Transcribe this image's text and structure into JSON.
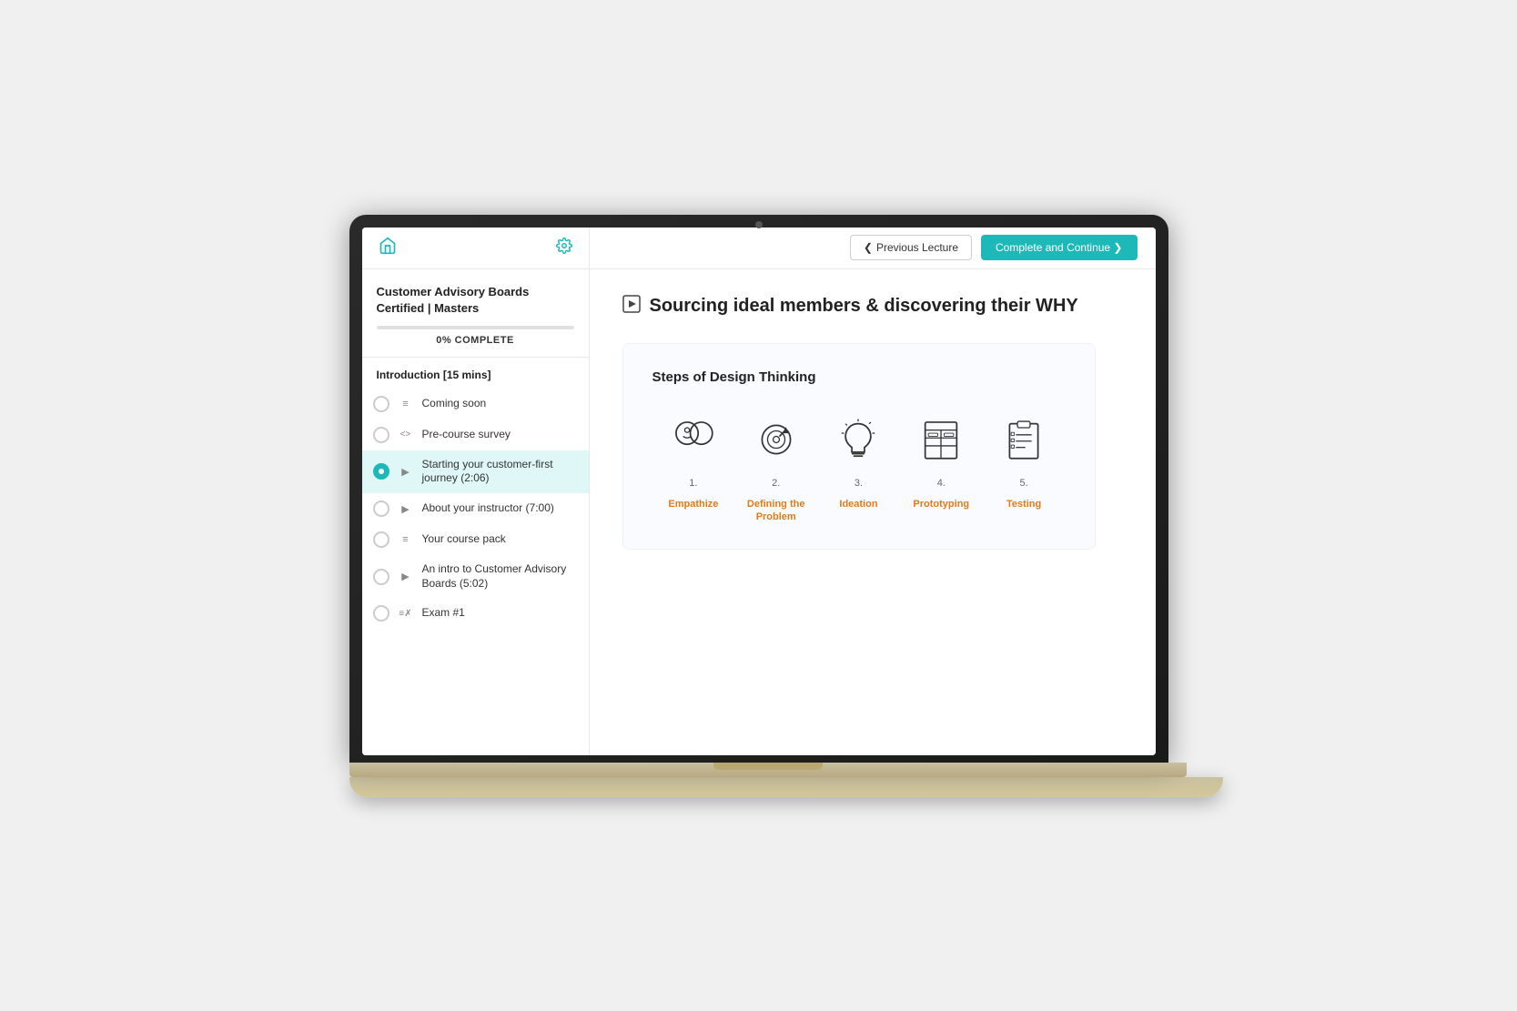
{
  "header": {
    "prev_button": "❮  Previous Lecture",
    "complete_button": "Complete and Continue  ❯"
  },
  "sidebar": {
    "course_title": "Customer Advisory Boards Certified | Masters",
    "progress_percent": "0%",
    "progress_label": "COMPLETE",
    "section_label": "Introduction [15 mins]",
    "lessons": [
      {
        "id": 1,
        "icon": "≡",
        "text": "Coming soon",
        "active": false
      },
      {
        "id": 2,
        "icon": "<>",
        "text": "Pre-course survey",
        "active": false
      },
      {
        "id": 3,
        "icon": "▶",
        "text": "Starting your customer-first journey (2:06)",
        "active": true
      },
      {
        "id": 4,
        "icon": "▶",
        "text": "About your instructor (7:00)",
        "active": false
      },
      {
        "id": 5,
        "icon": "≡",
        "text": "Your course pack",
        "active": false
      },
      {
        "id": 6,
        "icon": "▶",
        "text": "An intro to Customer Advisory Boards (5:02)",
        "active": false
      },
      {
        "id": 7,
        "icon": "≡✗",
        "text": "Exam #1",
        "active": false
      }
    ]
  },
  "content": {
    "lecture_title": "Sourcing ideal members & discovering their WHY",
    "design_thinking": {
      "section_title": "Steps of Design Thinking",
      "steps": [
        {
          "num": "1.",
          "label": "Empathize",
          "icon": "empathize"
        },
        {
          "num": "2.",
          "label": "Defining the Problem",
          "icon": "target"
        },
        {
          "num": "3.",
          "label": "Ideation",
          "icon": "lightbulb"
        },
        {
          "num": "4.",
          "label": "Prototyping",
          "icon": "prototype"
        },
        {
          "num": "5.",
          "label": "Testing",
          "icon": "testing"
        }
      ]
    }
  }
}
